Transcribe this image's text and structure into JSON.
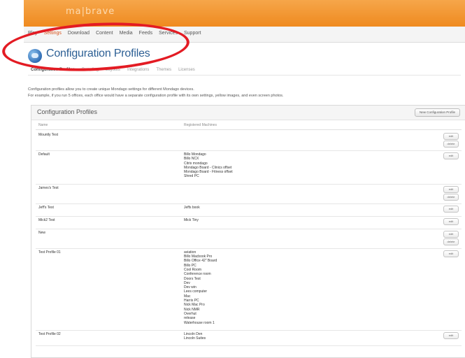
{
  "brand": {
    "logo_text": "ma|brave"
  },
  "nav": {
    "items": [
      "Play",
      "Settings",
      "Download",
      "Content",
      "Media",
      "Feeds",
      "Services",
      "Support"
    ],
    "active_index": 1
  },
  "page": {
    "title": "Configuration Profiles",
    "subtabs": [
      "Configuration Profiles",
      "Branding",
      "Layouts",
      "Integrations",
      "Themes",
      "Licenses"
    ],
    "active_subtab": 0,
    "desc_line1": "Configuration profiles allow you to create unique Mondago settings for different Mondago devices.",
    "desc_line2": "For example, if you run 5 offices, each office would have a separate configuration profile with its own settings, yellow images, and even screen photos."
  },
  "panel": {
    "title": "Configuration Profiles",
    "new_button": "New Configuration Profile",
    "col_name": "Name",
    "col_machines": "Registered Machines",
    "edit_label": "edit",
    "delete_label": "delete",
    "rows": [
      {
        "name": "Mountly Test",
        "machines": [],
        "buttons": [
          "edit",
          "delete"
        ]
      },
      {
        "name": "Default",
        "machines": [
          "Billo Mondago",
          "Billo NCX",
          "Citrix mondago",
          "Mondago Board - Clinics offset",
          "Mondago Board - Fitness offset",
          "Shred PC"
        ],
        "buttons": [
          "edit"
        ]
      },
      {
        "name": "James's Test",
        "machines": [],
        "buttons": [
          "edit",
          "delete"
        ]
      },
      {
        "name": "Jeff's Test",
        "machines": [
          "Jeffs book"
        ],
        "buttons": [
          "edit"
        ]
      },
      {
        "name": "Mick2 Test",
        "machines": [
          "Mick Tiny"
        ],
        "buttons": [
          "edit"
        ]
      },
      {
        "name": "New",
        "machines": [],
        "buttons": [
          "edit",
          "delete"
        ]
      },
      {
        "name": "Test Profile 01",
        "machines": [
          "aviation",
          "Billo Macbook Pro",
          "Billo Office 42\" Board",
          "Billo PC",
          "Cool Room",
          "Conference room",
          "Doors Test",
          "Dev",
          "Dev win",
          "Lees computer",
          "Mac",
          "Harris PC",
          "Nick Mac Pro",
          "Nick NMR",
          "Overhut",
          "release",
          "Waterhouse room 1"
        ],
        "buttons": [
          "edit"
        ]
      },
      {
        "name": "Test Profile 02",
        "machines": [
          "Lincoln Den",
          "Lincoln Suites"
        ],
        "buttons": [
          "edit"
        ]
      }
    ]
  }
}
